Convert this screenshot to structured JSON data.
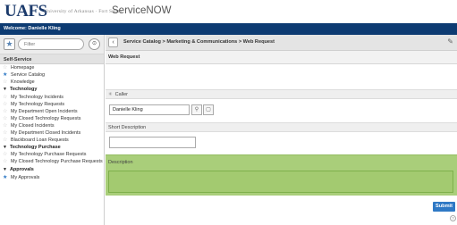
{
  "header": {
    "logo": "UAFS",
    "logo_subtitle": "University of Arkansas · Fort Smith",
    "app_name": "ServiceNOW"
  },
  "welcome": "Welcome: Danielle Kling",
  "sidebar": {
    "filter_placeholder": "Filter",
    "section_title": "Self-Service",
    "top_items": [
      {
        "label": "Homepage",
        "favorite": false
      },
      {
        "label": "Service Catalog",
        "favorite": true
      },
      {
        "label": "Knowledge",
        "favorite": false
      }
    ],
    "groups": [
      {
        "title": "Technology",
        "items": [
          "My Technology Incidents",
          "My Technology Requests",
          "My Department Open Incidents",
          "My Closed Technology Requests",
          "My Closed Incidents",
          "My Department Closed Incidents",
          "Blackboard Loan Requests"
        ]
      },
      {
        "title": "Technology Purchase",
        "items": [
          "My Technology Purchase Requests",
          "My Closed Technology Purchase Requests"
        ]
      },
      {
        "title": "Approvals",
        "items": [
          "My Approvals"
        ]
      }
    ]
  },
  "main": {
    "breadcrumb": "Service Catalog > Marketing & Communications > Web Request",
    "form_title": "Web Request",
    "caller_label": "Caller",
    "caller_value": "Danielle Kling",
    "short_description_label": "Short Description",
    "description_label": "Description",
    "submit_label": "Submit",
    "colors": {
      "brand_navy": "#0d3b72",
      "highlight_green": "#a9ce7a",
      "submit_blue": "#2f79c5"
    }
  }
}
